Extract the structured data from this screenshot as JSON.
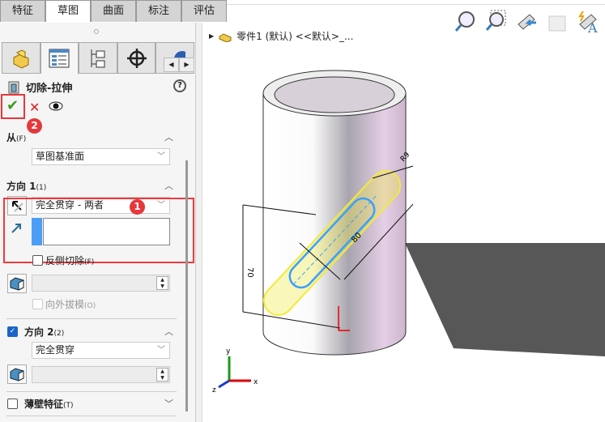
{
  "tabs": [
    "特征",
    "草图",
    "曲面",
    "标注",
    "评估"
  ],
  "active_tab": "草图",
  "feature": {
    "title": "切除-拉伸",
    "help": "?"
  },
  "actions": {
    "ok": "✔",
    "cancel": "✕",
    "badge2": "2"
  },
  "from": {
    "label": "从",
    "key": "(F)",
    "value": "草图基准面"
  },
  "dir1": {
    "label": "方向 1",
    "key": "(1)",
    "value": "完全贯穿 - 两者",
    "badge1": "1",
    "flip_side": "反侧切除",
    "flip_key": "(F)",
    "draft": "向外拔模",
    "draft_key": "(O)"
  },
  "dir2": {
    "label": "方向 2",
    "key": "(2)",
    "checked": true,
    "value": "完全贯穿"
  },
  "thin": {
    "label": "薄壁特征",
    "key": "(T)",
    "checked": false
  },
  "viewport": {
    "tree_label": "零件1 (默认) <<默认>_...",
    "dims": {
      "d1": "70",
      "d2": "80",
      "d3": "R9"
    },
    "triad": {
      "x": "x",
      "y": "y",
      "z": "z"
    }
  },
  "colors": {
    "accent": "#e5383b",
    "sketch": "#3aa0ff",
    "preview": "#f2ea3c"
  }
}
